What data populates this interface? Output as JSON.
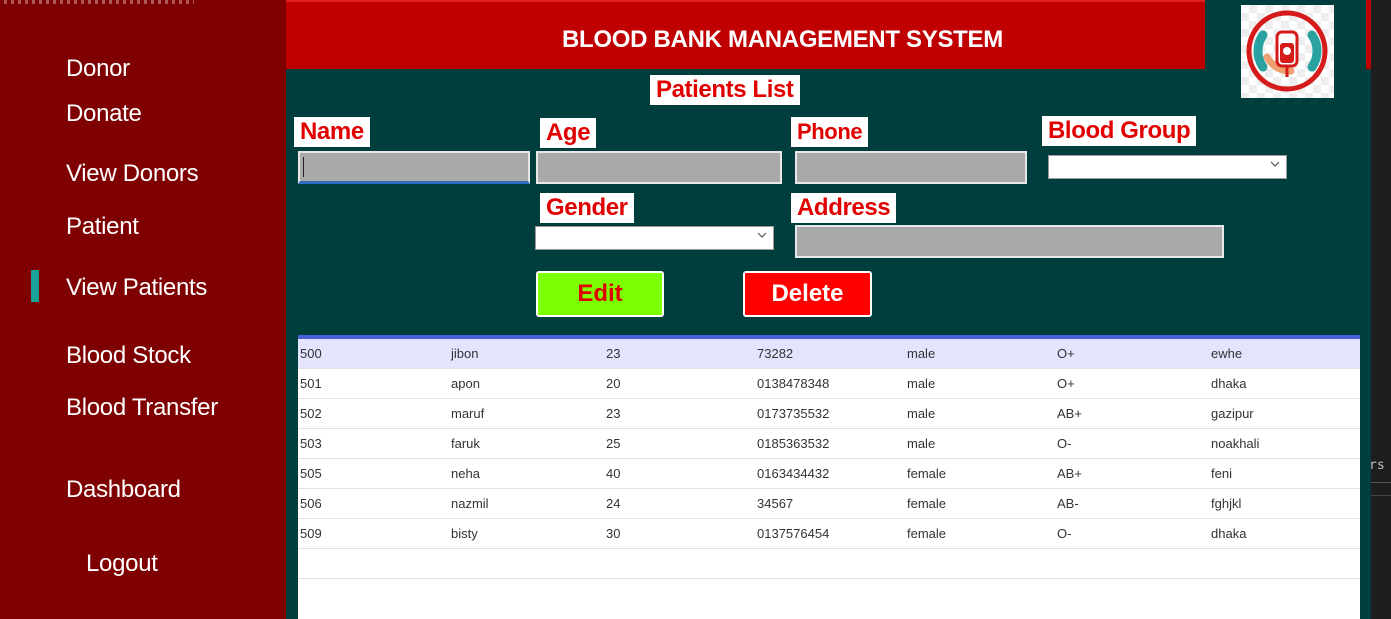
{
  "sidebar": {
    "items": [
      {
        "label": "Donor"
      },
      {
        "label": "Donate"
      },
      {
        "label": "View Donors"
      },
      {
        "label": "Patient"
      },
      {
        "label": "View Patients",
        "active": true
      },
      {
        "label": "Blood Stock"
      },
      {
        "label": "Blood Transfer"
      },
      {
        "label": "Dashboard"
      },
      {
        "label": "Logout"
      }
    ]
  },
  "header": {
    "title": "BLOOD BANK MANAGEMENT SYSTEM",
    "logo_icon": "blood-bank-logo-icon"
  },
  "form": {
    "heading": "Patients List",
    "name_label": "Name",
    "name_value": "",
    "age_label": "Age",
    "age_value": "",
    "phone_label": "Phone",
    "phone_value": "",
    "blood_group_label": "Blood Group",
    "blood_group_value": "",
    "gender_label": "Gender",
    "gender_value": "",
    "address_label": "Address",
    "address_value": "",
    "edit_label": "Edit",
    "delete_label": "Delete"
  },
  "table": {
    "rows": [
      [
        "500",
        "jibon",
        "23",
        "73282",
        "male",
        "O+",
        "ewhe"
      ],
      [
        "501",
        "apon",
        "20",
        "0138478348",
        "male",
        "O+",
        "dhaka"
      ],
      [
        "502",
        "maruf",
        "23",
        "0173735532",
        "male",
        "AB+",
        "gazipur"
      ],
      [
        "503",
        "faruk",
        "25",
        "0185363532",
        "male",
        "O-",
        "noakhali"
      ],
      [
        "505",
        "neha",
        "40",
        "0163434432",
        "female",
        "AB+",
        "feni"
      ],
      [
        "506",
        "nazmil",
        "24",
        "34567",
        "female",
        "AB-",
        "fghjkl"
      ],
      [
        "509",
        "bisty",
        "30",
        "0137576454",
        "female",
        "O-",
        "dhaka"
      ]
    ],
    "selected_row": 0
  },
  "editor_fragment": {
    "text": "rs"
  },
  "colors": {
    "sidebar": "#7f0000",
    "header": "#c00000",
    "main": "#003d3d",
    "label_text": "#e00000",
    "edit_button": "#7cff00",
    "delete_button": "#ff0000",
    "active_indicator": "#1aa39a"
  }
}
